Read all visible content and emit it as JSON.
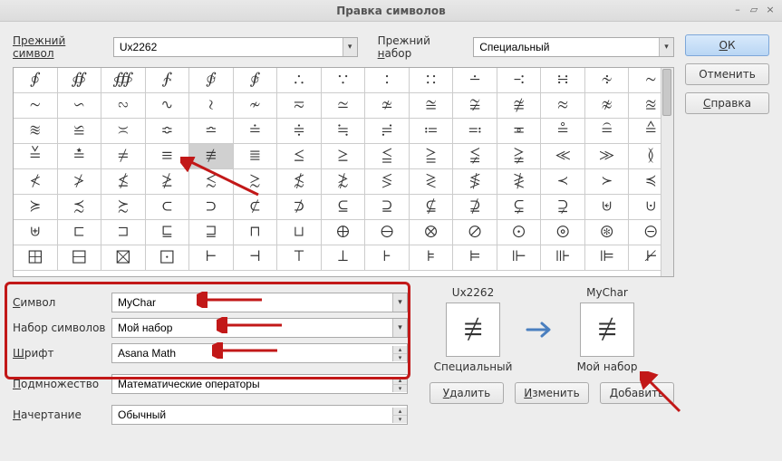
{
  "title": "Правка символов",
  "top": {
    "prev_symbol_lbl": "Прежний символ",
    "prev_symbol_val": "Ux2262",
    "prev_set_lbl": "Прежний набор",
    "prev_set_val": "Специальный"
  },
  "buttons": {
    "ok": "OK",
    "cancel": "Отменить",
    "help": "Справка",
    "delete": "Удалить",
    "change": "Изменить",
    "add": "Добавить"
  },
  "grid": {
    "rows": [
      [
        "∮",
        "∯",
        "∰",
        "∱",
        "∲",
        "∳",
        "∴",
        "∵",
        "∶",
        "∷",
        "∸",
        "∹",
        "∺",
        "∻",
        "∼"
      ],
      [
        "∼",
        "∽",
        "∾",
        "∿",
        "≀",
        "≁",
        "≂",
        "≃",
        "≄",
        "≅",
        "≆",
        "≇",
        "≈",
        "≉",
        "≊"
      ],
      [
        "≋",
        "≌",
        "≍",
        "≎",
        "≏",
        "≐",
        "≑",
        "≒",
        "≓",
        "≔",
        "≕",
        "≖",
        "≗",
        "≘",
        "≙"
      ],
      [
        "≚",
        "≛",
        "≠",
        "≡",
        "≢",
        "≣",
        "≤",
        "≥",
        "≦",
        "≧",
        "≨",
        "≩",
        "≪",
        "≫",
        "≬"
      ],
      [
        "≮",
        "≯",
        "≰",
        "≱",
        "≲",
        "≳",
        "≴",
        "≵",
        "≶",
        "≷",
        "≸",
        "≹",
        "≺",
        "≻",
        "≼"
      ],
      [
        "≽",
        "≾",
        "≿",
        "⊂",
        "⊃",
        "⊄",
        "⊅",
        "⊆",
        "⊇",
        "⊈",
        "⊉",
        "⊊",
        "⊋",
        "⊌",
        "⊍"
      ],
      [
        "⊎",
        "⊏",
        "⊐",
        "⊑",
        "⊒",
        "⊓",
        "⊔",
        "⊕",
        "⊖",
        "⊗",
        "⊘",
        "⊙",
        "⊚",
        "⊛",
        "⊝"
      ],
      [
        "⊞",
        "⊟",
        "⊠",
        "⊡",
        "⊢",
        "⊣",
        "⊤",
        "⊥",
        "⊦",
        "⊧",
        "⊨",
        "⊩",
        "⊪",
        "⊫",
        "⊬"
      ]
    ],
    "selected": [
      3,
      4
    ]
  },
  "fields": {
    "symbol_lbl": "Символ",
    "symbol_val": "MyChar",
    "set_lbl": "Набор символов",
    "set_val": "Мой набор",
    "font_lbl": "Шрифт",
    "font_val": "Asana Math",
    "subset_lbl": "Подмножество",
    "subset_val": "Математические операторы",
    "style_lbl": "Начертание",
    "style_val": "Обычный"
  },
  "preview": {
    "left_name": "Ux2262",
    "left_set": "Специальный",
    "right_name": "MyChar",
    "right_set": "Мой набор",
    "glyph": "≢"
  }
}
